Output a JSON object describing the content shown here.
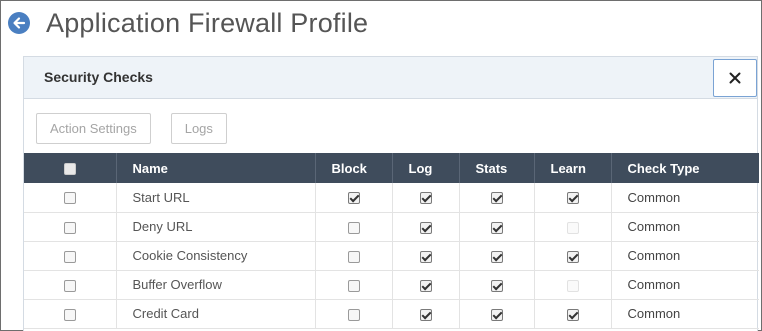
{
  "page": {
    "title": "Application Firewall Profile"
  },
  "panel": {
    "title": "Security Checks",
    "close_label": "✕"
  },
  "toolbar": {
    "action_settings": "Action Settings",
    "logs": "Logs"
  },
  "table": {
    "columns": [
      "Name",
      "Block",
      "Log",
      "Stats",
      "Learn",
      "Check Type"
    ],
    "rows": [
      {
        "name": "Start URL",
        "block": true,
        "log": true,
        "stats": true,
        "learn": "checked",
        "check_type": "Common"
      },
      {
        "name": "Deny URL",
        "block": false,
        "log": true,
        "stats": true,
        "learn": "disabled",
        "check_type": "Common"
      },
      {
        "name": "Cookie Consistency",
        "block": false,
        "log": true,
        "stats": true,
        "learn": "checked",
        "check_type": "Common"
      },
      {
        "name": "Buffer Overflow",
        "block": false,
        "log": true,
        "stats": true,
        "learn": "disabled",
        "check_type": "Common"
      },
      {
        "name": "Credit Card",
        "block": false,
        "log": true,
        "stats": true,
        "learn": "checked",
        "check_type": "Common"
      }
    ]
  },
  "colors": {
    "back_button": "#4a7fc1",
    "table_header": "#3f4c5c",
    "panel_header": "#eef3f8"
  },
  "icons": {
    "back": "back-arrow-icon",
    "close": "close-icon"
  }
}
